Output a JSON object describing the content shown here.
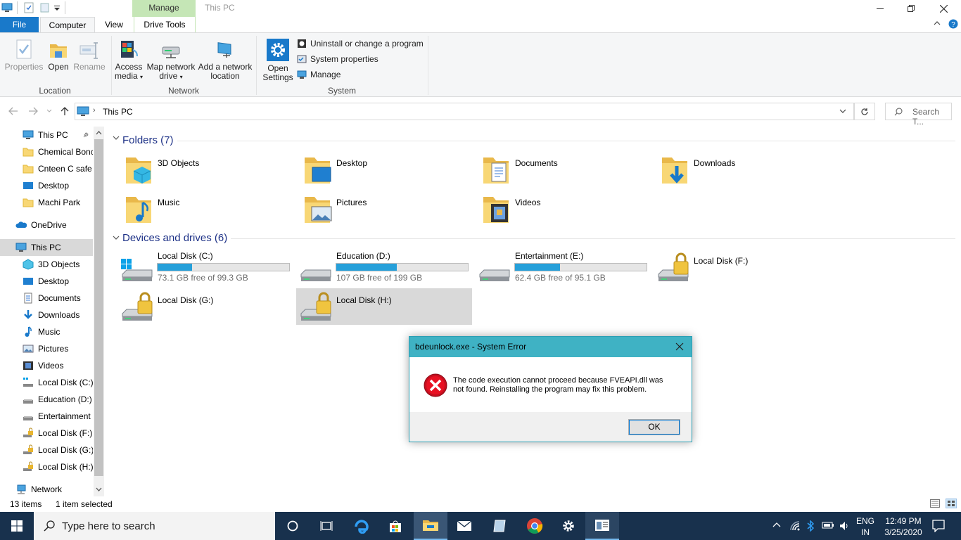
{
  "window": {
    "title": "This PC",
    "context_tab": "Manage"
  },
  "ribbon": {
    "tabs": [
      "File",
      "Computer",
      "View",
      "Drive Tools"
    ],
    "location": {
      "group": "Location",
      "properties": "Properties",
      "open": "Open",
      "rename": "Rename"
    },
    "network": {
      "group": "Network",
      "access_media_1": "Access",
      "access_media_2": "media",
      "map_drive_1": "Map network",
      "map_drive_2": "drive",
      "add_location_1": "Add a network",
      "add_location_2": "location"
    },
    "system": {
      "group": "System",
      "open_settings_1": "Open",
      "open_settings_2": "Settings",
      "uninstall": "Uninstall or change a program",
      "sys_props": "System properties",
      "manage": "Manage"
    }
  },
  "address": {
    "path": "This PC",
    "search_placeholder": "Search T..."
  },
  "nav": {
    "quick": [
      {
        "label": "This PC",
        "icon": "pc-icon"
      },
      {
        "label": "Chemical Bonc",
        "icon": "folder-icon"
      },
      {
        "label": "Cnteen C safe",
        "icon": "folder-icon"
      },
      {
        "label": "Desktop",
        "icon": "desktop-icon"
      },
      {
        "label": "Machi Park",
        "icon": "folder-icon"
      }
    ],
    "onedrive": "OneDrive",
    "thispc": "This PC",
    "pc_items": [
      "3D Objects",
      "Desktop",
      "Documents",
      "Downloads",
      "Music",
      "Pictures",
      "Videos",
      "Local Disk (C:)",
      "Education (D:)",
      "Entertainment",
      "Local Disk (F:)",
      "Local Disk (G:)",
      "Local Disk (H:)"
    ],
    "network": "Network"
  },
  "content": {
    "folders_header": "Folders (7)",
    "folders": [
      "3D Objects",
      "Desktop",
      "Documents",
      "Downloads",
      "Music",
      "Pictures",
      "Videos"
    ],
    "drives_header": "Devices and drives (6)",
    "drives": [
      {
        "name": "Local Disk (C:)",
        "free": "73.1 GB free of 99.3 GB",
        "used_fraction": 0.26
      },
      {
        "name": "Education (D:)",
        "free": "107 GB free of 199 GB",
        "used_fraction": 0.46
      },
      {
        "name": "Entertainment (E:)",
        "free": "62.4 GB free of 95.1 GB",
        "used_fraction": 0.34
      },
      {
        "name": "Local Disk (F:)"
      },
      {
        "name": "Local Disk (G:)"
      },
      {
        "name": "Local Disk (H:)"
      }
    ]
  },
  "status": {
    "items": "13 items",
    "selected": "1 item selected"
  },
  "dialog": {
    "title": "bdeunlock.exe - System Error",
    "message_1": "The code execution cannot proceed because FVEAPI.dll was",
    "message_2": "not found. Reinstalling the program may fix this problem.",
    "ok": "OK"
  },
  "taskbar": {
    "search_placeholder": "Type here to search",
    "lang_1": "ENG",
    "lang_2": "IN",
    "time": "12:49 PM",
    "date": "3/25/2020"
  },
  "colors": {
    "accent": "#1979ca",
    "drive_bar": "#26a0da",
    "manage_tab": "#c5e6b6",
    "dialog_title": "#3fb2c4",
    "taskbar": "#18314d"
  }
}
